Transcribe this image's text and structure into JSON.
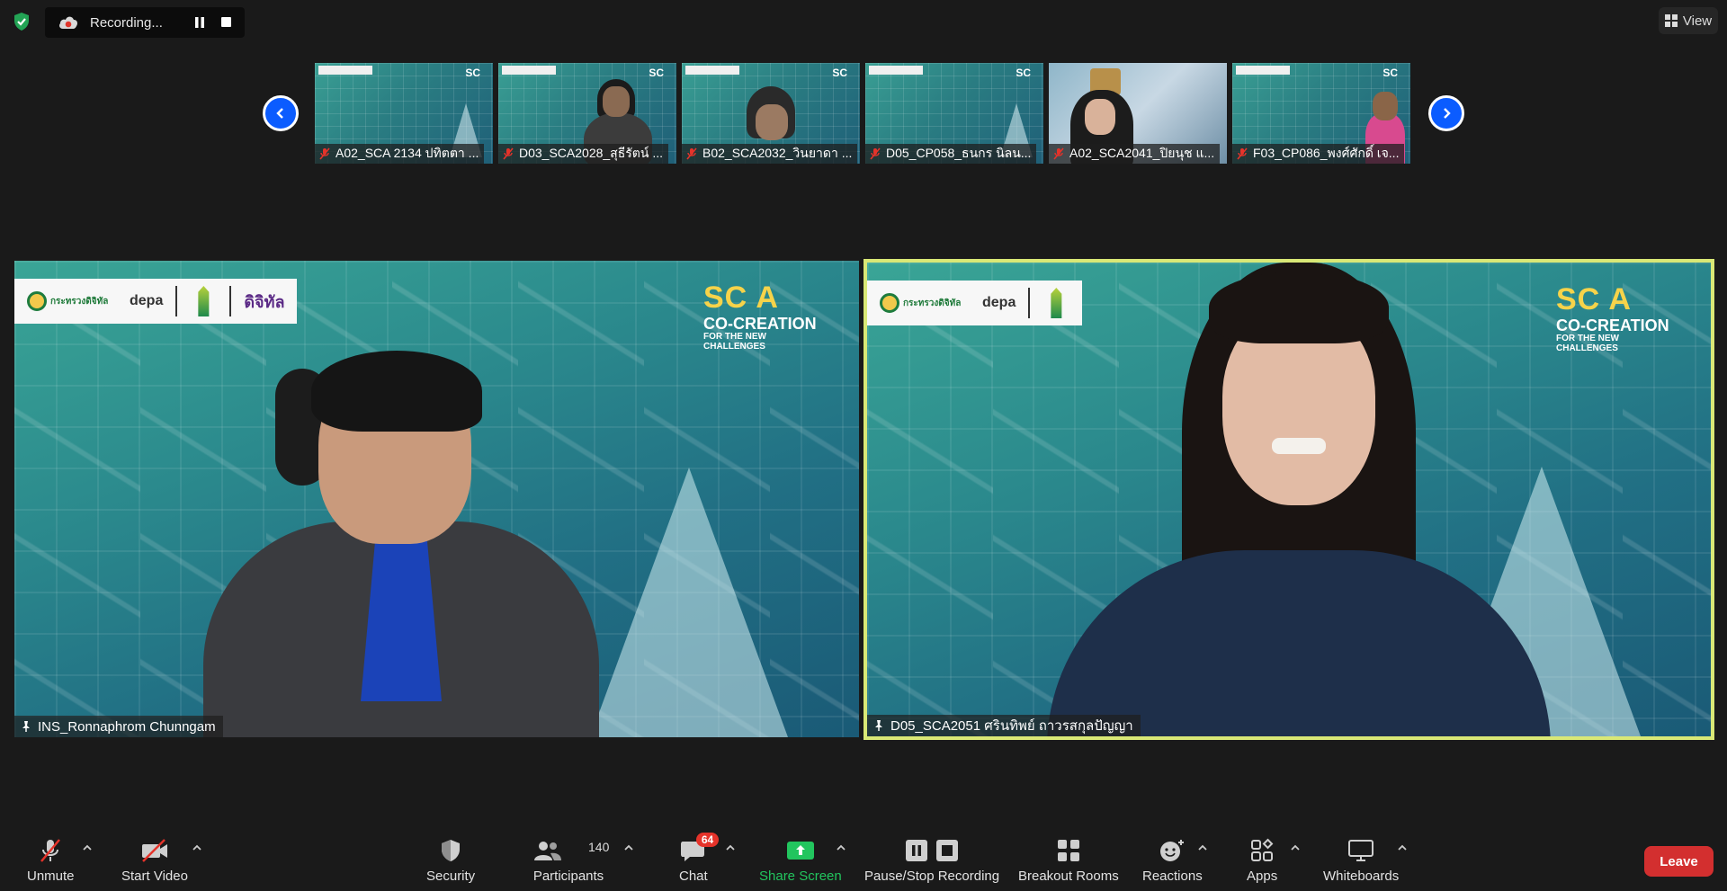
{
  "recording": {
    "label": "Recording..."
  },
  "view": {
    "label": "View"
  },
  "thumbnails": [
    {
      "name": "A02_SCA 2134 ปทิตตา ..."
    },
    {
      "name": "D03_SCA2028_สุธีรัตน์ ..."
    },
    {
      "name": "B02_SCA2032_วินยาดา ..."
    },
    {
      "name": "D05_CP058_ธนกร นิลน..."
    },
    {
      "name": "A02_SCA2041_ปิยนุช แ..."
    },
    {
      "name": "F03_CP086_พงศ์ศักดิ์ เจ..."
    }
  ],
  "main_videos": {
    "left": {
      "name": "INS_Ronnaphrom Chunngam",
      "brand": {
        "ministry": "กระทรวงดิจิทัล",
        "agency": "depa",
        "digital": "ดิจิทัล"
      },
      "sca": {
        "sc": "SC",
        "a": "A",
        "title": "CO-CREATION",
        "subtitle": "FOR THE NEW CHALLENGES"
      }
    },
    "right": {
      "name": "D05_SCA2051 ศรินทิพย์ ถาวรสกุลปัญญา",
      "brand": {
        "ministry": "กระทรวงดิจิทัล",
        "agency": "depa"
      },
      "sca": {
        "sc": "SC",
        "a": "A",
        "title": "CO-CREATION",
        "subtitle": "FOR THE NEW CHALLENGES"
      }
    }
  },
  "toolbar": {
    "unmute": "Unmute",
    "start_video": "Start Video",
    "security": "Security",
    "participants": "Participants",
    "participants_count": "140",
    "chat": "Chat",
    "chat_badge": "64",
    "share_screen": "Share Screen",
    "pause_stop": "Pause/Stop Recording",
    "breakout": "Breakout Rooms",
    "reactions": "Reactions",
    "apps": "Apps",
    "whiteboards": "Whiteboards",
    "leave": "Leave"
  },
  "colors": {
    "accent_blue": "#0b5cff",
    "speaker_border": "#d9e876",
    "leave_red": "#d32f2f",
    "share_green": "#22c55e"
  }
}
